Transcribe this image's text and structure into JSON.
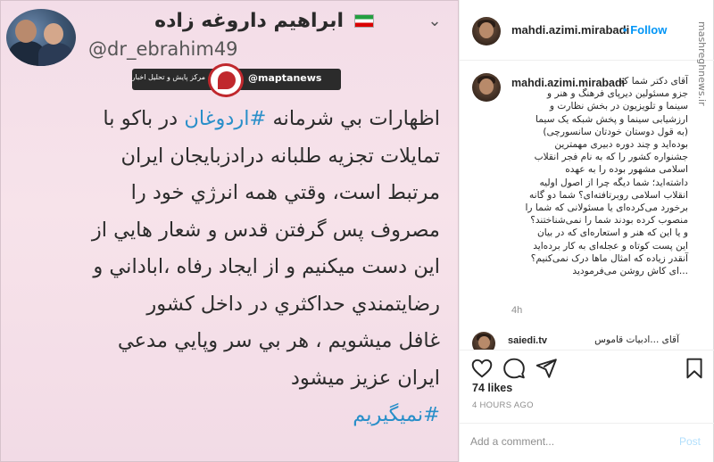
{
  "tweet": {
    "display_name": "ابراهیم داروغه زاده",
    "handle": "@dr_ebrahim49",
    "more_glyph": "⌄",
    "watermark": {
      "right_text": "@maptanews",
      "left_text": "مرکز پایش و تحلیل اخبار"
    },
    "lines": [
      {
        "pre": "اظهارات بي شرمانه ",
        "hash": "#اردوغان",
        "post": " در باکو با"
      },
      {
        "pre": "تمايلات تجزيه طلبانه درادزبايجان ايران",
        "hash": "",
        "post": ""
      },
      {
        "pre": "مرتبط است، وقتي همه انرژي خود را",
        "hash": "",
        "post": ""
      },
      {
        "pre": "مصروف پس گرفتن قدس و شعار هايي از",
        "hash": "",
        "post": ""
      },
      {
        "pre": "اين دست ميکنيم و از ايجاد رفاه ،اباداني و",
        "hash": "",
        "post": ""
      },
      {
        "pre": "رضايتمندي حداکثري در داخل کشور",
        "hash": "",
        "post": ""
      },
      {
        "pre": "غافل ميشويم ، هر بي سر وپايي مدعي",
        "hash": "",
        "post": ""
      },
      {
        "pre": "ايران عزيز ميشود",
        "hash": "",
        "post": ""
      },
      {
        "pre": "",
        "hash": "#نميگيريم",
        "post": ""
      }
    ]
  },
  "instagram": {
    "header": {
      "username": "mahdi.azimi.mirabadi",
      "dot": "•",
      "follow_label": "Follow",
      "side_watermark": "mashreghnews.ir"
    },
    "caption": {
      "username": "mahdi.azimi.mirabadi",
      "lines": [
        "آقای دکتر شما که",
        "جزو مسئولین دیرپای فرهنگ و هنر و",
        "سینما و تلویزیون در بخش نظارت و",
        "ارزشیابی سینما و پخش شبکه یک سیما",
        "(به قول دوستان خودتان سانسورچی)",
        "بوده‌اید و چند دوره دبیری مهمترین",
        "جشنواره کشور را که به نام فجر انقلاب",
        "اسلامی مشهور بوده را به عهده",
        "داشته‌اید؛ شما دیگه چرا از اصول اولیه",
        "انقلاب اسلامی روبرتافته‌ای؟ شما دو گانه",
        "برخورد می‌کرده‌ای یا مسئولانی که شما را",
        "منصوب کرده بودند شما را نمی‌شناختند؟",
        "و یا این که هنر و استعاره‌ای که در بیان",
        "این پست کوتاه و عجله‌ای به کار برده‌اید",
        "آنقدر زیاده که امثال ماها درک نمی‌کنیم؟",
        "...ای کاش روشن می‌فرمودید"
      ],
      "time": "4h"
    },
    "comment_peek": {
      "user": "saiedi.tv",
      "text": "آقای ...ادبیات قاموس"
    },
    "likes": "74 likes",
    "post_age": "4 HOURS AGO",
    "comment_form": {
      "placeholder": "Add a comment...",
      "post_label": "Post"
    }
  }
}
